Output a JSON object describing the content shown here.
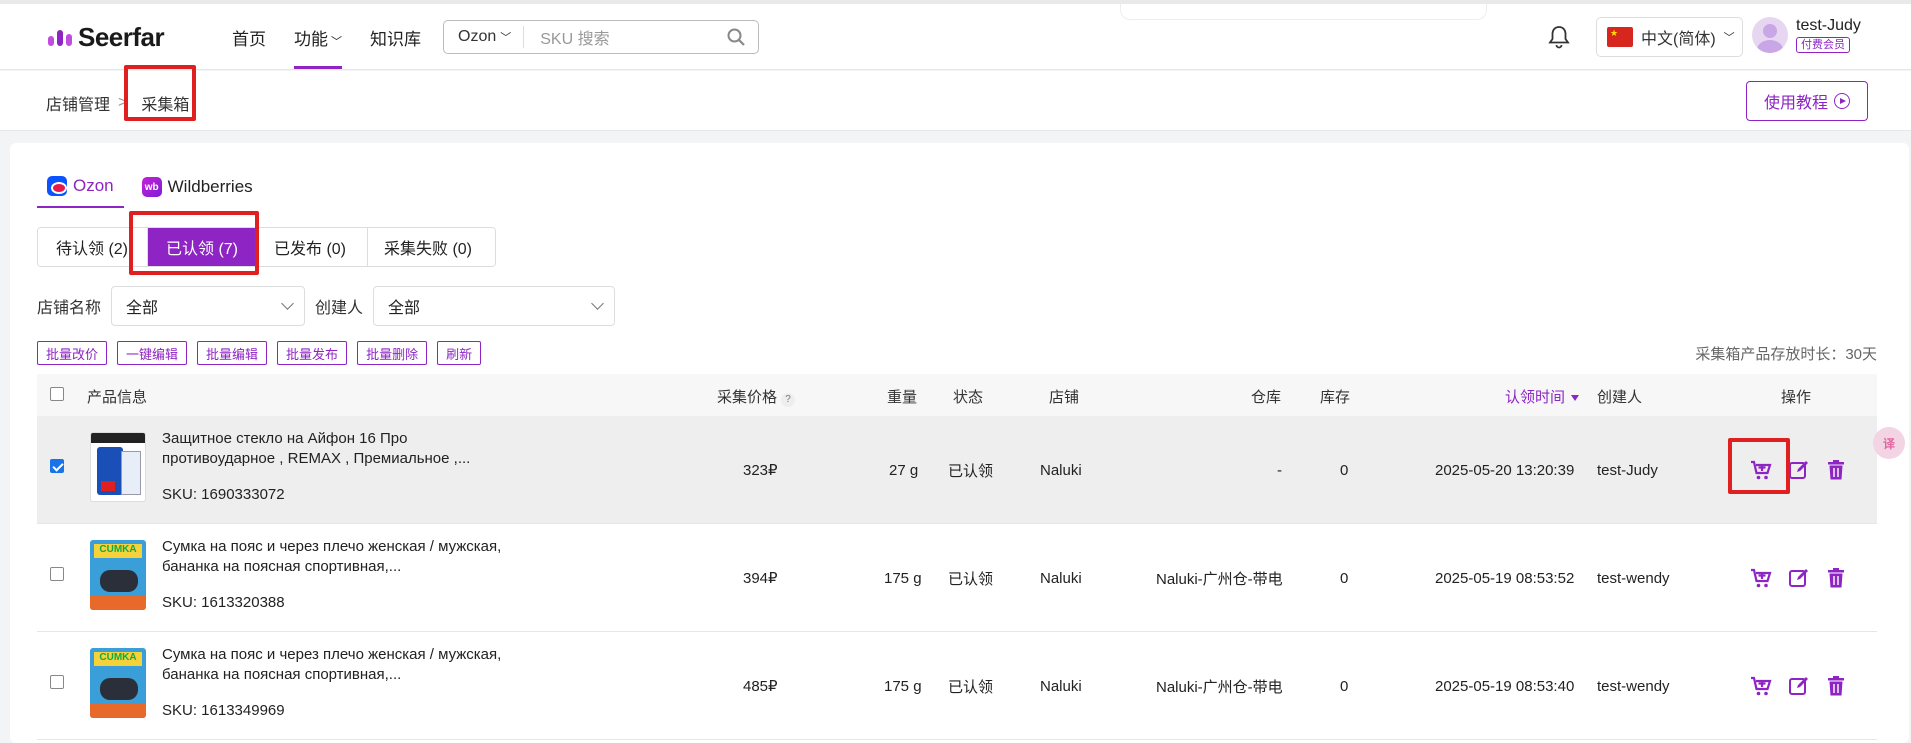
{
  "header": {
    "logo": "Seerfar",
    "nav": [
      "首页",
      "功能",
      "知识库"
    ],
    "search_platform": "Ozon",
    "search_placeholder": "SKU 搜索",
    "language": "中文(简体)",
    "user_name": "test-Judy",
    "user_badge": "付费会员"
  },
  "breadcrumb": {
    "parent": "店铺管理",
    "sep": ">",
    "current": "采集箱"
  },
  "tutorial_label": "使用教程",
  "platform_tabs": [
    {
      "label": "Ozon",
      "icon": "ozon-logo-icon"
    },
    {
      "label": "Wildberries",
      "icon": "wildberries-logo-icon"
    }
  ],
  "status_tabs": [
    "待认领 (2)",
    "已认领 (7)",
    "已发布 (0)",
    "采集失败 (0)"
  ],
  "filters": {
    "store_label": "店铺名称",
    "store_value": "全部",
    "creator_label": "创建人",
    "creator_value": "全部"
  },
  "batch_buttons": [
    "批量改价",
    "一键编辑",
    "批量编辑",
    "批量发布",
    "批量删除",
    "刷新"
  ],
  "retention_note": "采集箱产品存放时长：30天",
  "columns": {
    "product": "产品信息",
    "price": "采集价格",
    "weight": "重量",
    "status": "状态",
    "store": "店铺",
    "warehouse": "仓库",
    "stock": "库存",
    "claim_time": "认领时间",
    "creator": "创建人",
    "actions": "操作"
  },
  "rows": [
    {
      "selected": true,
      "title": "Защитное стекло на Айфон 16 Про противоударное , REMAX , Премиальное ,...",
      "sku": "SKU: 1690333072",
      "price": "323₽",
      "weight": "27 g",
      "status": "已认领",
      "store": "Naluki",
      "warehouse": "-",
      "stock": "0",
      "claim_time": "2025-05-20 13:20:39",
      "creator": "test-Judy"
    },
    {
      "selected": false,
      "title": "Сумка на пояс и через плечо женская / мужская, бананка на поясная спортивная,...",
      "sku": "SKU: 1613320388",
      "price": "394₽",
      "weight": "175 g",
      "status": "已认领",
      "store": "Naluki",
      "warehouse": "Naluki-广州仓-带电",
      "stock": "0",
      "claim_time": "2025-05-19 08:53:52",
      "creator": "test-wendy"
    },
    {
      "selected": false,
      "title": "Сумка на пояс и через плечо женская / мужская, бананка на поясная спортивная,...",
      "sku": "SKU: 1613349969",
      "price": "485₽",
      "weight": "175 g",
      "status": "已认领",
      "store": "Naluki",
      "warehouse": "Naluki-广州仓-带电",
      "stock": "0",
      "claim_time": "2025-05-19 08:53:40",
      "creator": "test-wendy"
    }
  ],
  "colors": {
    "accent": "#8e24c4",
    "highlight": "#e02020"
  }
}
